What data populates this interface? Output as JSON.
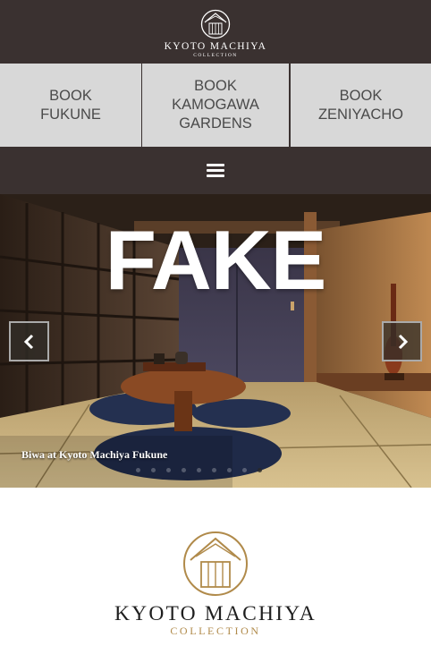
{
  "header": {
    "brand": "KYOTO MACHIYA",
    "sub": "COLLECTION",
    "logo_icon": "machiya-house-logo-icon"
  },
  "booking": [
    {
      "line1": "BOOK",
      "line2": "FUKUNE",
      "line3": ""
    },
    {
      "line1": "BOOK",
      "line2": "KAMOGAWA",
      "line3": "GARDENS"
    },
    {
      "line1": "BOOK",
      "line2": "ZENIYACHO",
      "line3": ""
    }
  ],
  "nav": {
    "menu_icon": "hamburger-menu-icon"
  },
  "slider": {
    "title": "FAKE",
    "caption": "Biwa at Kyoto Machiya Fukune",
    "prev_icon": "chevron-left-icon",
    "next_icon": "chevron-right-icon",
    "dot_count": 9,
    "active_dot": 8
  },
  "footer_logo": {
    "brand": "KYOTO MACHIYA",
    "sub": "COLLECTION"
  },
  "colors": {
    "header_bg": "#3a3130",
    "button_bg": "#d8d8d8",
    "button_text": "#4a4a4a",
    "gold": "#b08a4a"
  }
}
